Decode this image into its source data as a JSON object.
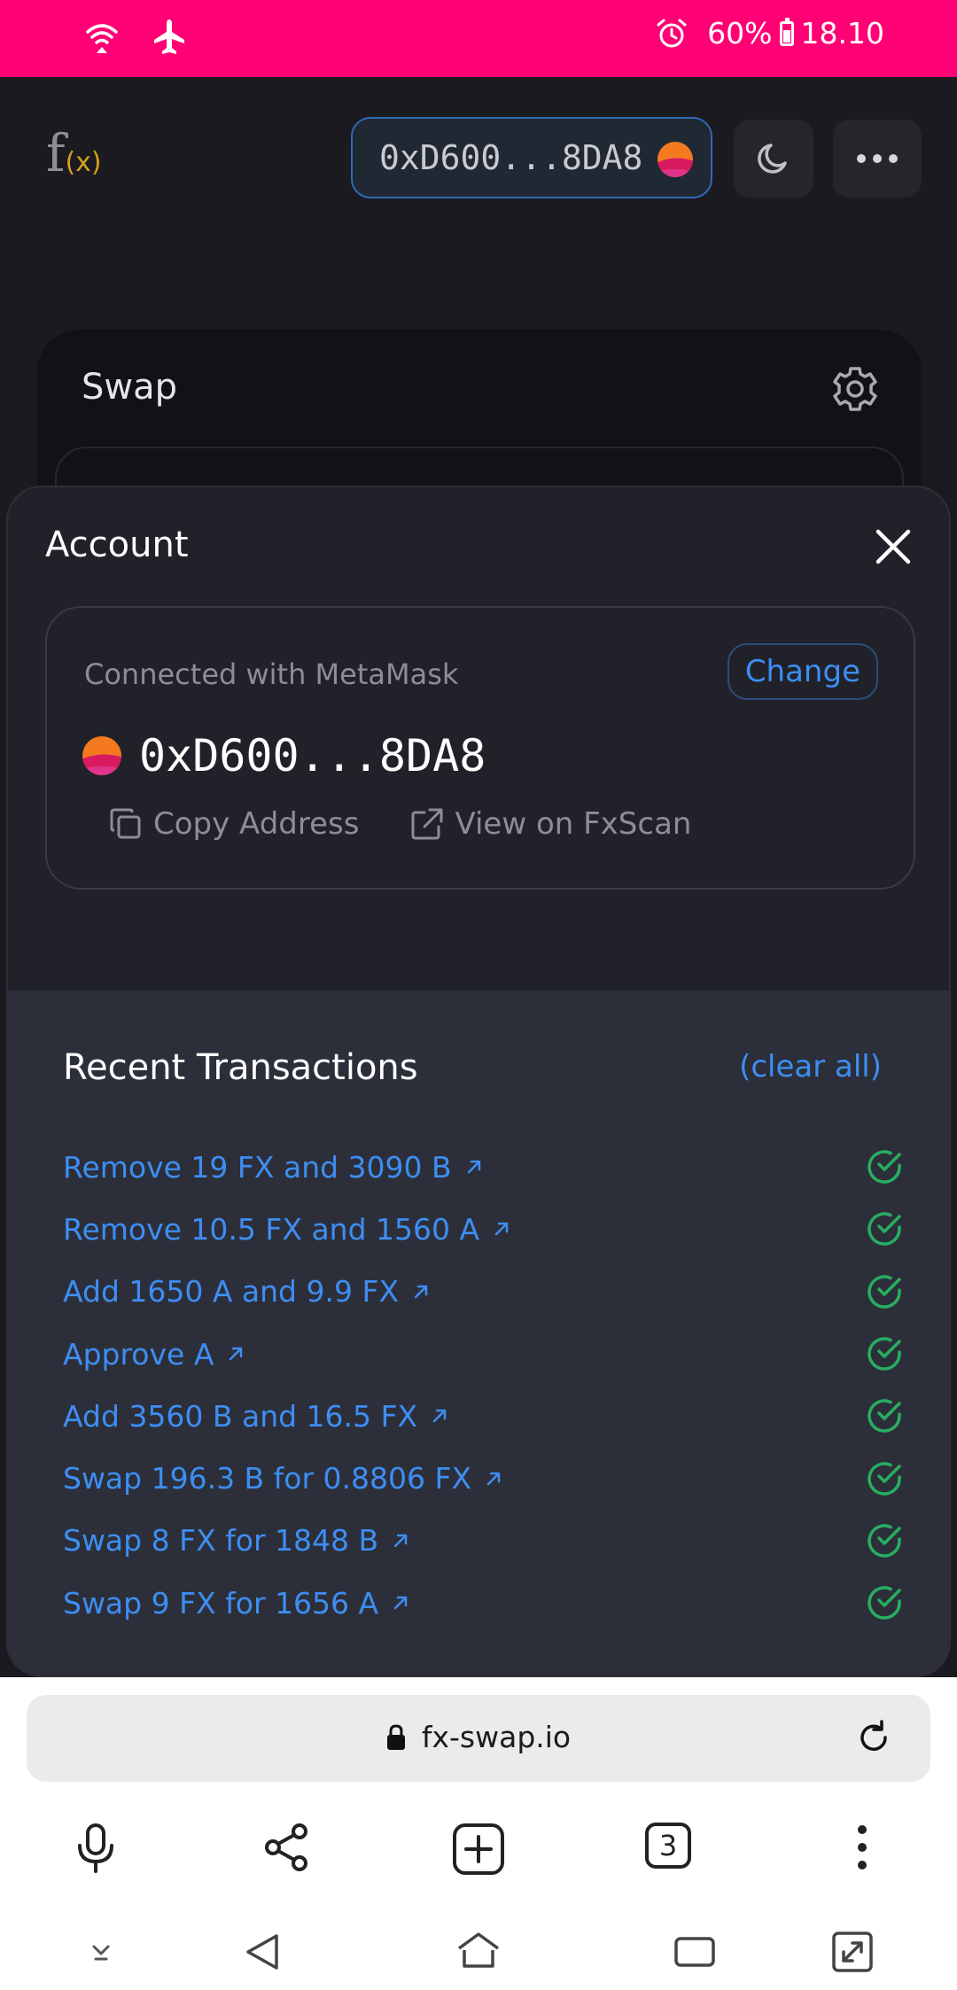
{
  "status_bar": {
    "battery": "60%",
    "time": "18.10",
    "battery_level": 0.6
  },
  "header": {
    "logo_main": "f",
    "logo_sub": "(x)",
    "wallet_address": "0xD600...8DA8"
  },
  "swap_card": {
    "title": "Swap"
  },
  "account_modal": {
    "title": "Account",
    "connected_with": "Connected with MetaMask",
    "change_label": "Change",
    "address": "0xD600...8DA8",
    "copy_label": "Copy Address",
    "view_label": "View on FxScan",
    "recent_title": "Recent Transactions",
    "clear_label": "(clear all)",
    "transactions": [
      {
        "label": "Remove 19 FX and 3090 B"
      },
      {
        "label": "Remove 10.5 FX and 1560 A"
      },
      {
        "label": "Add 1650 A and 9.9 FX"
      },
      {
        "label": "Approve A"
      },
      {
        "label": "Add 3560 B and 16.5 FX"
      },
      {
        "label": "Swap 196.3 B for 0.8806 FX"
      },
      {
        "label": "Swap 8 FX for 1848 B"
      },
      {
        "label": "Swap 9 FX for 1656 A"
      }
    ]
  },
  "browser": {
    "url": "fx-swap.io",
    "tab_count": "3"
  },
  "colors": {
    "status_bar": "#ff0075",
    "link_blue": "#3d8ef2",
    "success_green": "#27ae60",
    "modal_bg": "#212129",
    "recent_bg": "#2c2f3a"
  }
}
